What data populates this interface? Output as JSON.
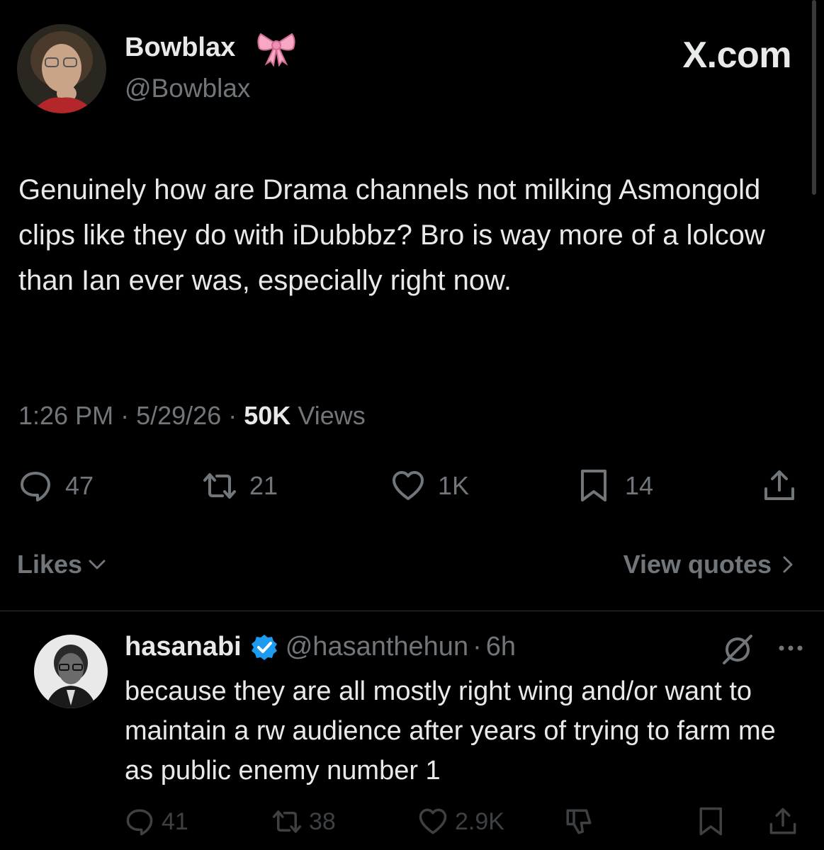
{
  "tweet": {
    "author_name": "Bowblax",
    "author_handle": "@Bowblax",
    "watermark": "X.com",
    "text": "Genuinely how are Drama channels not milking Asmongold clips like they do with iDubbbz? Bro is way more of a lolcow than Ian ever was, especially right now.",
    "time": "1:26 PM",
    "date": "5/29/26",
    "separator": "·",
    "views_count": "50K",
    "views_label": "Views",
    "replies": "47",
    "reposts": "21",
    "likes": "1K",
    "bookmarks": "14",
    "likes_link": "Likes",
    "view_quotes_link": "View quotes"
  },
  "reply": {
    "author_name": "hasanabi",
    "author_handle": "@hasanthehun",
    "age": "6h",
    "text": "because they are all mostly right wing and/or want to maintain a rw audience after years of trying to farm me as public enemy number 1",
    "replies": "41",
    "reposts": "38",
    "likes": "2.9K"
  },
  "icons": {
    "bow": "ribbon-bow-emoji",
    "reply": "speech-bubble-icon",
    "repost": "repost-arrows-icon",
    "like": "heart-icon",
    "bookmark": "bookmark-icon",
    "share": "share-upload-icon",
    "verified": "verified-badge-icon",
    "grok": "grok-icon",
    "more": "more-dots-icon",
    "dislike": "thumbs-down-icon"
  },
  "colors": {
    "background": "#000000",
    "text": "#e7e9ea",
    "muted": "#71767b",
    "verified": "#1d9bf0",
    "bow": "#f7a8c4",
    "divider": "#2f3336"
  }
}
